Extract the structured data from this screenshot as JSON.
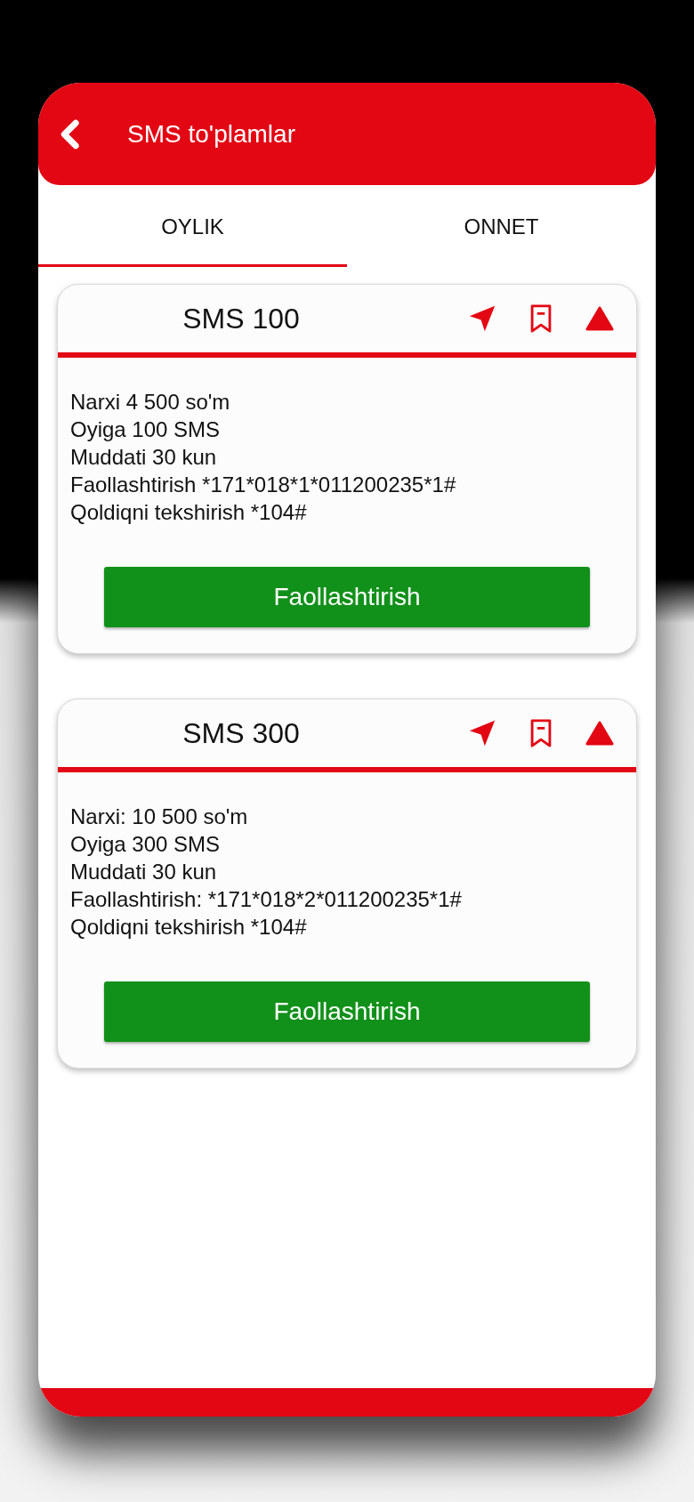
{
  "header": {
    "title": "SMS to'plamlar"
  },
  "tabs": [
    {
      "label": "OYLIK",
      "selected": true
    },
    {
      "label": "ONNET",
      "selected": false
    }
  ],
  "cards": [
    {
      "title": "SMS 100",
      "lines": [
        "Narxi 4 500 so'm",
        "Oyiga 100 SMS",
        "Muddati 30 kun",
        "Faollashtirish *171*018*1*011200235*1#",
        "Qoldiqni tekshirish *104#"
      ],
      "button": "Faollashtirish"
    },
    {
      "title": "SMS 300",
      "lines": [
        "Narxi: 10 500 so'm",
        "Oyiga 300 SMS",
        "Muddati 30 kun",
        "Faollashtirish: *171*018*2*011200235*1#",
        "Qoldiqni tekshirish *104#"
      ],
      "button": "Faollashtirish"
    }
  ]
}
